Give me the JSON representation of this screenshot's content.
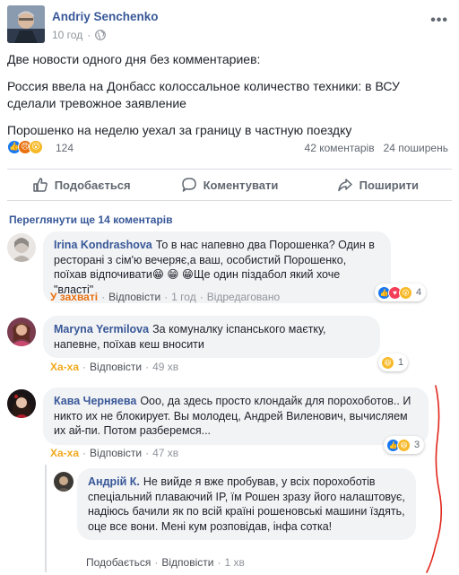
{
  "post": {
    "author": "Andriy Senchenko",
    "time": "10 год",
    "body": [
      "Две новости одного дня без комментариев:",
      "Россия ввела на Донбасс колоссальное количество техники: в ВСУ сделали тревожное заявление",
      "Порошенко на неделю уехал за границу в частную поездку"
    ],
    "reaction_count": "124",
    "comments_count": "42 коментарів",
    "shares_count": "24 поширень"
  },
  "actions": {
    "like": "Подобається",
    "comment": "Коментувати",
    "share": "Поширити"
  },
  "view_more": "Переглянути ще 14 коментарів",
  "comments": [
    {
      "name": "Irina Kondrashova",
      "text": "То в нас напевно два Порошенка? Один в ресторані з сім'ю вечеряє,а ваш, особистий Порошенко, поїхав відпочивати😁 😁 😁Ще один пiздабол який хоче \"власті\"",
      "reaction": "У захваті",
      "reply": "Відповісти",
      "time": "1 год",
      "edited": "Відредаговано",
      "badge_count": "4"
    },
    {
      "name": "Maryna Yermilova",
      "text": "За комуналку іспанського маєтку, напевне, поїхав кеш вносити",
      "reaction": "Ха-ха",
      "reply": "Відповісти",
      "time": "49 хв",
      "badge_count": "1"
    },
    {
      "name": "Кава Черняева",
      "text": "Ооо, да здесь просто клондайк для порохоботов.. И никто их не блокирует. Вы молодец, Андрей Виленович, вычисляем их ай-пи. Потом разберемся...",
      "reaction": "Ха-ха",
      "reply": "Відповісти",
      "time": "47 хв",
      "badge_count": "3"
    },
    {
      "name": "Андрій К.",
      "text": "Не вийде я вже пробував, у всіх порохоботів спеціальний плаваючий IP, їм Рошен зразу його налаштовує, надіюсь бачили як по всій країні рошеновські машини їздять, оце все вони. Мені кум розповідав, інфа сотка!",
      "like": "Подобається",
      "reply": "Відповісти",
      "time": "1 хв"
    }
  ],
  "colors": {
    "link_blue": "#385898",
    "angry_orange": "#e9710f",
    "haha_yellow": "#f0a91c",
    "like_blue": "#1877f2",
    "annotation_red": "#e0261b"
  }
}
